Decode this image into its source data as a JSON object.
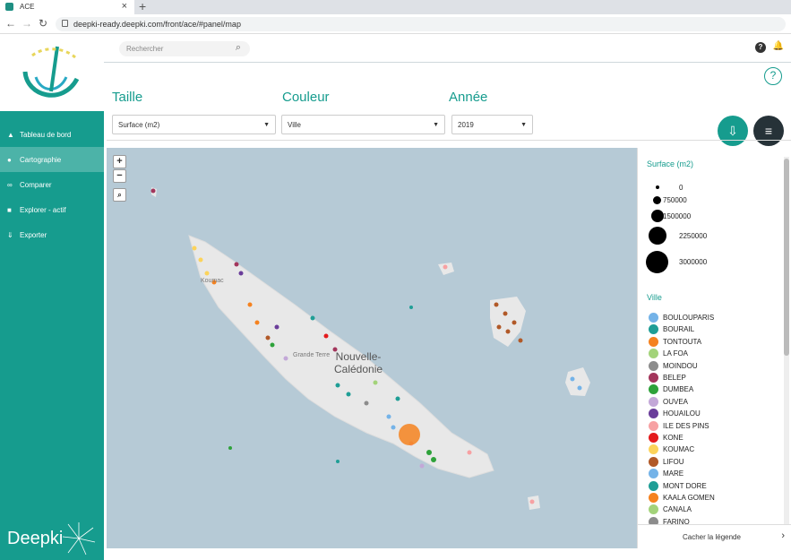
{
  "browser": {
    "tab_title": "ACE",
    "url": "deepki-ready.deepki.com/front/ace/#panel/map"
  },
  "sidebar": {
    "items": [
      {
        "label": "Tableau de bord",
        "icon": "dashboard-icon"
      },
      {
        "label": "Cartographie",
        "icon": "globe-icon"
      },
      {
        "label": "Comparer",
        "icon": "binoculars-icon"
      },
      {
        "label": "Explorer - actif",
        "icon": "book-icon"
      },
      {
        "label": "Exporter",
        "icon": "download-icon"
      }
    ],
    "brand": "Deepki"
  },
  "header": {
    "search_placeholder": "Rechercher"
  },
  "filters": {
    "taille": {
      "label": "Taille",
      "value": "Surface (m2)"
    },
    "couleur": {
      "label": "Couleur",
      "value": "Ville"
    },
    "annee": {
      "label": "Année",
      "value": "2019"
    }
  },
  "map": {
    "label_territory": "Nouvelle-Caledonie",
    "label_territory_line1": "Nouvelle-",
    "label_territory_line2": "Calédonie",
    "label_koumac": "Koumac",
    "label_grandeterre": "Grande Terre",
    "zoom_in": "+",
    "zoom_out": "−"
  },
  "legend": {
    "size_title": "Surface (m2)",
    "sizes": [
      "0",
      "750000",
      "1500000",
      "2250000",
      "3000000"
    ],
    "color_title": "Ville",
    "cities": [
      {
        "name": "BOULOUPARIS",
        "color": "#74b3e8"
      },
      {
        "name": "BOURAIL",
        "color": "#1f9e96"
      },
      {
        "name": "TONTOUTA",
        "color": "#f5821f"
      },
      {
        "name": "LA FOA",
        "color": "#a3d37a"
      },
      {
        "name": "MOINDOU",
        "color": "#8c8c8c"
      },
      {
        "name": "BELEP",
        "color": "#a3365c"
      },
      {
        "name": "DUMBEA",
        "color": "#2ea23a"
      },
      {
        "name": "OUVEA",
        "color": "#c3a8d8"
      },
      {
        "name": "HOUAILOU",
        "color": "#6a3d9a"
      },
      {
        "name": "ILE DES PINS",
        "color": "#f7a1a3"
      },
      {
        "name": "KONE",
        "color": "#e41a1c"
      },
      {
        "name": "KOUMAC",
        "color": "#fcd35a"
      },
      {
        "name": "LIFOU",
        "color": "#b15928"
      },
      {
        "name": "MARE",
        "color": "#74b3e8"
      },
      {
        "name": "MONT DORE",
        "color": "#1f9e96"
      },
      {
        "name": "KAALA GOMEN",
        "color": "#f5821f"
      },
      {
        "name": "CANALA",
        "color": "#a3d37a"
      },
      {
        "name": "FARINO",
        "color": "#8c8c8c"
      }
    ],
    "footer": "Cacher la légende"
  },
  "colors": {
    "brand_teal": "#169c8e",
    "map_water": "#b6cad6",
    "dark_fab": "#263238"
  }
}
